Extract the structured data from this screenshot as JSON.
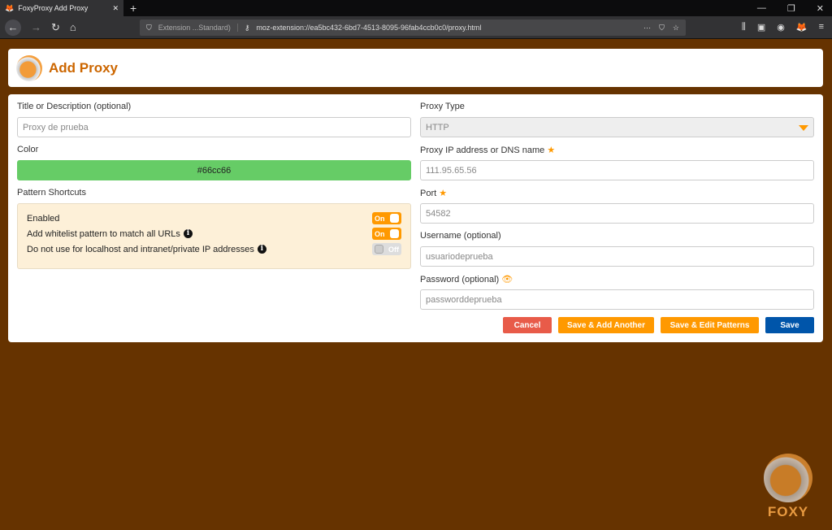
{
  "browser": {
    "tab_title": "FoxyProxy Add Proxy",
    "extension_label": "Extension ...Standard)",
    "url": "moz-extension://ea5bc432-6bd7-4513-8095-96fab4ccb0c0/proxy.html"
  },
  "header": {
    "title": "Add Proxy"
  },
  "form": {
    "title_label": "Title or Description (optional)",
    "title_placeholder": "Proxy de prueba",
    "color_label": "Color",
    "color_value": "#66cc66",
    "shortcuts_label": "Pattern Shortcuts",
    "shortcuts": [
      {
        "label": "Enabled",
        "state": "On",
        "on": true
      },
      {
        "label": "Add whitelist pattern to match all URLs",
        "state": "On",
        "on": true
      },
      {
        "label": "Do not use for localhost and intranet/private IP addresses",
        "state": "Off",
        "on": false
      }
    ],
    "proxy_type_label": "Proxy Type",
    "proxy_type": "HTTP",
    "ip_label": "Proxy IP address or DNS name",
    "ip_placeholder": "111.95.65.56",
    "port_label": "Port",
    "port_placeholder": "54582",
    "username_label": "Username (optional)",
    "username_placeholder": "usuariodeprueba",
    "password_label": "Password (optional)",
    "password_placeholder": "passworddeprueba"
  },
  "buttons": {
    "cancel": "Cancel",
    "save_add": "Save & Add Another",
    "save_edit": "Save & Edit Patterns",
    "save": "Save"
  },
  "watermark": "FOXY",
  "colors": {
    "accent": "#ff9900",
    "title": "#cc6600",
    "background": "#663300",
    "save": "#0055aa",
    "cancel": "#e85b49"
  }
}
